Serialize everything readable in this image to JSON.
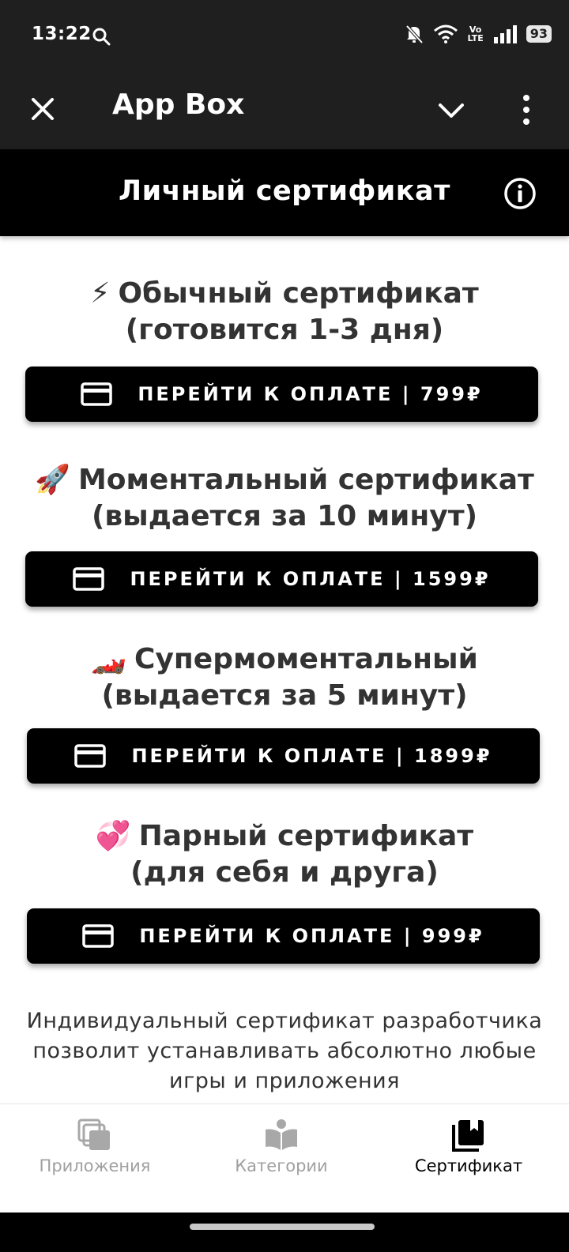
{
  "status_bar": {
    "time": "13:22",
    "battery": "93",
    "network": "Vo LTE",
    "icons": [
      "search-icon",
      "bell-off-icon",
      "wifi-icon",
      "volte-icon",
      "signal-icon",
      "battery-icon"
    ]
  },
  "app_bar": {
    "title": "App Box",
    "icons": [
      "close-icon",
      "chevron-down-icon",
      "more-vertical-icon"
    ]
  },
  "page": {
    "title": "Личный сертификат",
    "icon": "info-icon"
  },
  "offers": [
    {
      "emoji": "⚡",
      "title_line1": "Обычный сертификат",
      "title_line2": "(готовится 1-3 дня)",
      "button_label": "ПЕРЕЙТИ К ОПЛАТЕ | 799₽"
    },
    {
      "emoji": "🚀",
      "title_line1": "Моментальный сертификат",
      "title_line2": "(выдается за 10 минут)",
      "button_label": "ПЕРЕЙТИ К ОПЛАТЕ | 1599₽"
    },
    {
      "emoji": "🏎️",
      "title_line1": "Супермоментальный",
      "title_line2": "(выдается за 5 минут)",
      "button_label": "ПЕРЕЙТИ К ОПЛАТЕ | 1899₽"
    },
    {
      "emoji": "💞",
      "title_line1": "Парный сертификат",
      "title_line2": "(для себя и друга)",
      "button_label": "ПЕРЕЙТИ К ОПЛАТЕ | 999₽"
    }
  ],
  "description": "Индивидуальный сертификат разработчика позволит устанавливать абсолютно любые игры и приложения",
  "bottom_nav": {
    "items": [
      {
        "label": "Приложения",
        "icon": "apps-stack-icon",
        "active": false
      },
      {
        "label": "Категории",
        "icon": "open-book-icon",
        "active": false
      },
      {
        "label": "Сертификат",
        "icon": "certificate-icon",
        "active": true
      }
    ]
  },
  "colors": {
    "top_bar": "#1f1f1f",
    "header": "#000000",
    "button": "#000000",
    "text": "#333333",
    "inactive_nav": "#a0a0a0"
  }
}
